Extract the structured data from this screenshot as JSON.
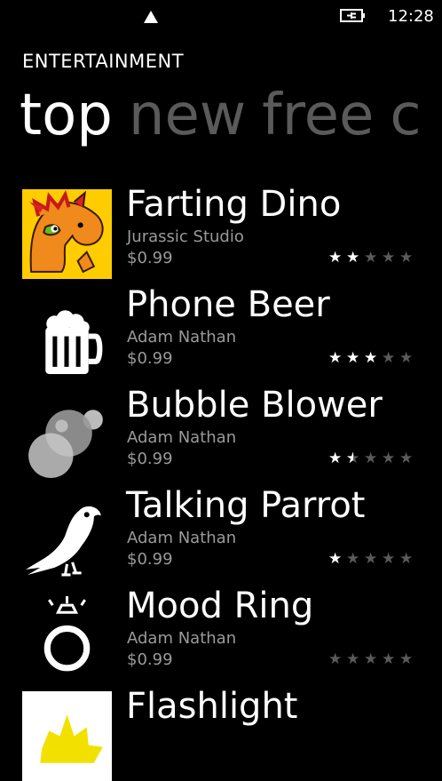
{
  "status": {
    "time": "12:28",
    "signal_icon": "signal-icon",
    "battery_icon": "battery-charging-icon"
  },
  "header": {
    "section": "ENTERTAINMENT"
  },
  "pivot": [
    "top",
    "new",
    "free",
    "c"
  ],
  "apps": [
    {
      "title": "Farting Dino",
      "publisher": "Jurassic Studio",
      "price": "$0.99",
      "rating": 2,
      "icon": "dino-icon"
    },
    {
      "title": "Phone Beer",
      "publisher": "Adam Nathan",
      "price": "$0.99",
      "rating": 3,
      "icon": "beer-mug-icon"
    },
    {
      "title": "Bubble Blower",
      "publisher": "Adam Nathan",
      "price": "$0.99",
      "rating": 1.5,
      "icon": "bubbles-icon"
    },
    {
      "title": "Talking Parrot",
      "publisher": "Adam Nathan",
      "price": "$0.99",
      "rating": 1,
      "icon": "parrot-icon"
    },
    {
      "title": "Mood Ring",
      "publisher": "Adam Nathan",
      "price": "$0.99",
      "rating": 0,
      "icon": "ring-icon"
    },
    {
      "title": "Flashlight",
      "icon": "flashlight-icon"
    }
  ]
}
